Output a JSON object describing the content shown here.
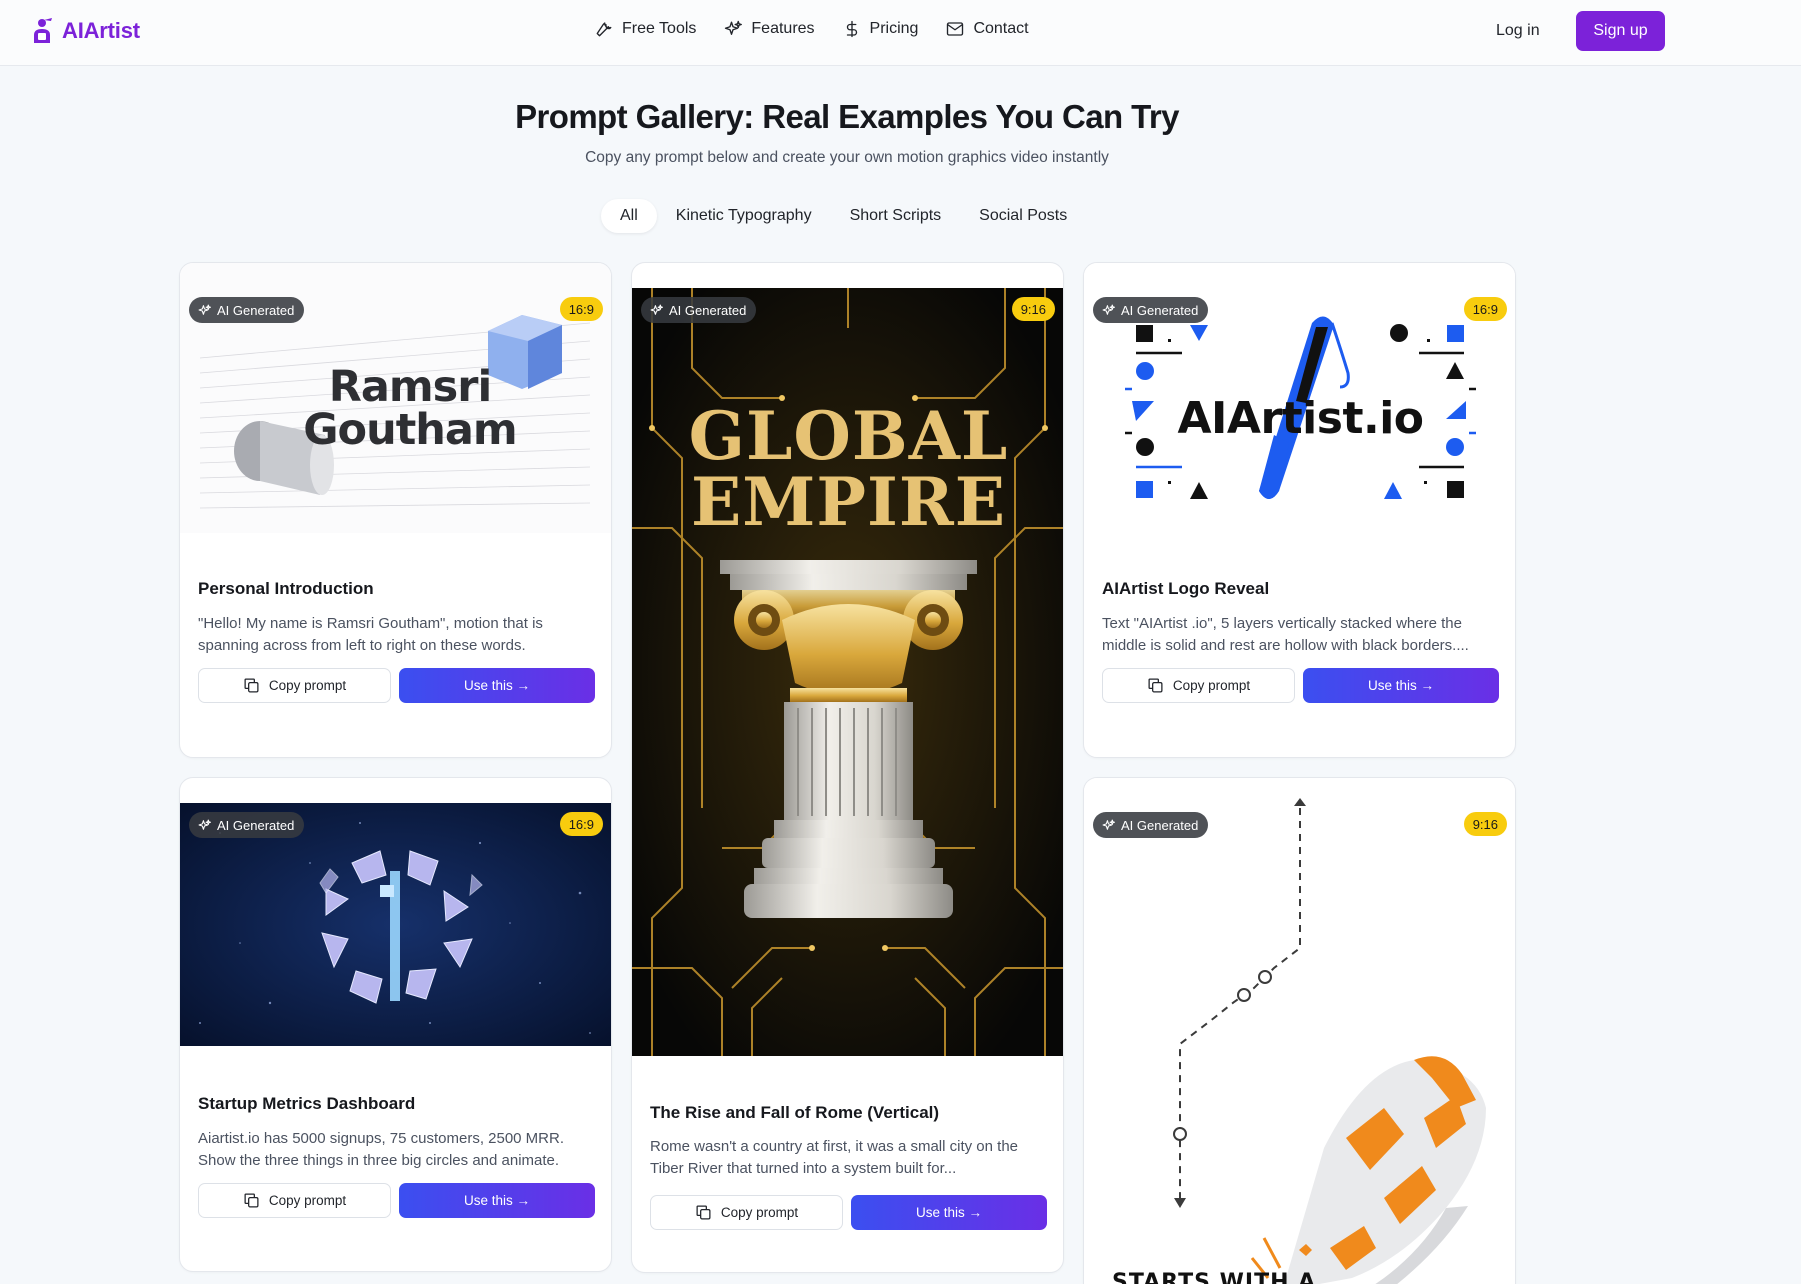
{
  "brand": {
    "name": "AIArtist",
    "color": "#7c22d9"
  },
  "nav": {
    "links": [
      {
        "label": "Free Tools",
        "icon": "wrench-icon"
      },
      {
        "label": "Features",
        "icon": "sparkles-icon"
      },
      {
        "label": "Pricing",
        "icon": "dollar-icon"
      },
      {
        "label": "Contact",
        "icon": "mail-icon"
      }
    ],
    "login_label": "Log in",
    "signup_label": "Sign up"
  },
  "hero": {
    "title": "Prompt Gallery: Real Examples You Can Try",
    "subtitle": "Copy any prompt below and create your own motion graphics video instantly"
  },
  "tabs": [
    {
      "label": "All",
      "active": true
    },
    {
      "label": "Kinetic Typography",
      "active": false
    },
    {
      "label": "Short Scripts",
      "active": false
    },
    {
      "label": "Social Posts",
      "active": false
    }
  ],
  "cards": [
    {
      "badge": "AI Generated",
      "ratio": "16:9",
      "title": "Personal Introduction",
      "description": "\"Hello! My name is Ramsri Goutham\", motion that is spanning across from left to right on these words.",
      "preview_text": [
        "Ramsri",
        "Goutham"
      ],
      "copy_label": "Copy prompt",
      "use_label": "Use this →"
    },
    {
      "badge": "AI Generated",
      "ratio": "9:16",
      "title": "The Rise and Fall of Rome (Vertical)",
      "description": "Rome wasn't a country at first, it was a small city on the Tiber River that turned into a system built for...",
      "preview_text": [
        "GLOBAL",
        "EMPIRE"
      ],
      "copy_label": "Copy prompt",
      "use_label": "Use this →"
    },
    {
      "badge": "AI Generated",
      "ratio": "16:9",
      "title": "AIArtist Logo Reveal",
      "description": "Text \"AIArtist .io\", 5 layers vertically stacked where the middle is solid and rest are hollow with black borders....",
      "preview_text": [
        "AIArtist.io"
      ],
      "copy_label": "Copy prompt",
      "use_label": "Use this →"
    },
    {
      "badge": "AI Generated",
      "ratio": "16:9",
      "title": "Startup Metrics Dashboard",
      "description": "Aiartist.io has 5000 signups, 75 customers, 2500 MRR. Show the three things in three big circles and animate.",
      "copy_label": "Copy prompt",
      "use_label": "Use this →"
    },
    {
      "badge": "AI Generated",
      "ratio": "9:16",
      "preview_text": [
        "STARTS WITH A"
      ]
    }
  ]
}
